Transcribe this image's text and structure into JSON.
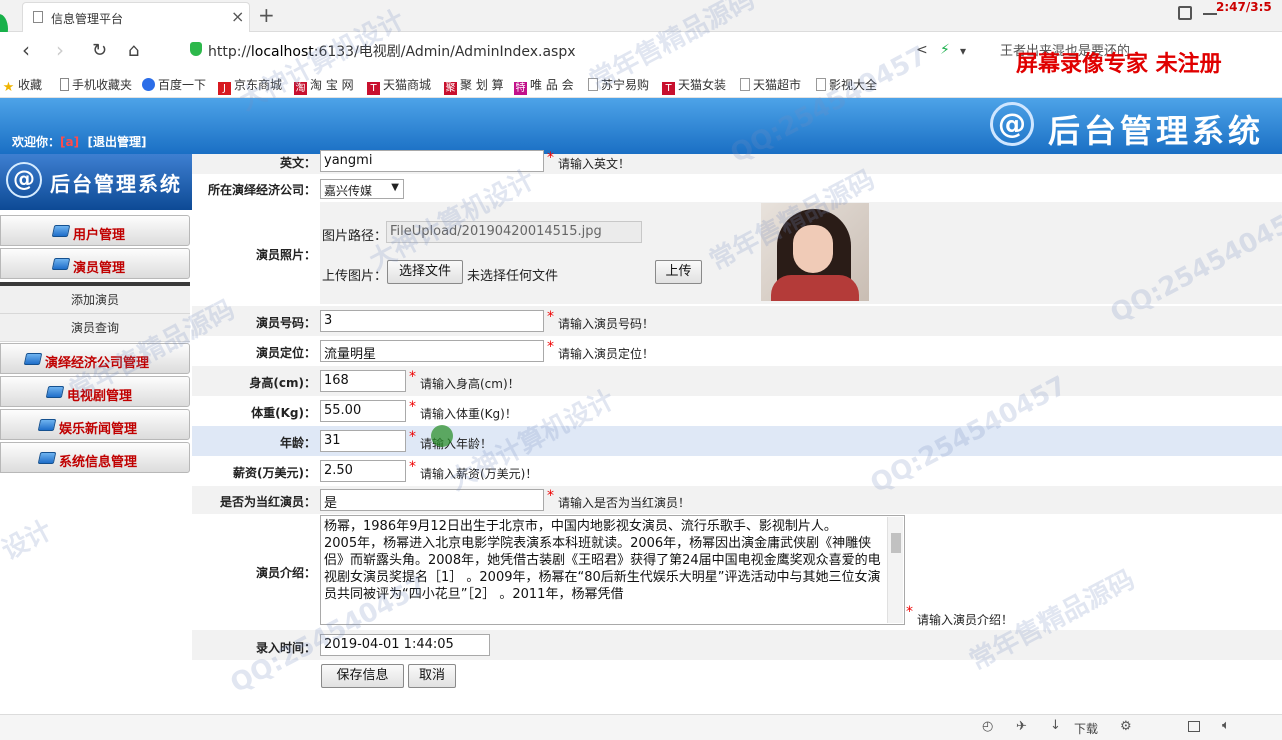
{
  "browser": {
    "tab_title": "信息管理平台",
    "tab_close": "×",
    "new_tab": "+",
    "url_prefix": "http://",
    "url_host": "localhost",
    "url_rest": ":6133/电视剧/Admin/AdminIndex.aspx",
    "search_text": "王者出来混也是要还的",
    "clock": "2:47/3:5"
  },
  "recorder_watermark": "屏幕录像专家 未注册",
  "bookmarks": [
    {
      "label": "收藏",
      "icon": "star-icon",
      "color": "#f0b400"
    },
    {
      "label": "手机收藏夹",
      "icon": "phone-icon",
      "color": "#888888"
    },
    {
      "label": "百度一下",
      "icon": "paw-icon",
      "color": "#2b6de8"
    },
    {
      "label": "京东商城",
      "icon": "jd-icon",
      "color": "#d71920"
    },
    {
      "label": "淘 宝 网",
      "icon": "taobao-icon",
      "color": "#c8102e"
    },
    {
      "label": "天猫商城",
      "icon": "tmall-icon",
      "color": "#c8102e"
    },
    {
      "label": "聚 划 算",
      "icon": "ju-icon",
      "color": "#c8102e"
    },
    {
      "label": "唯 品 会",
      "icon": "vip-icon",
      "color": "#c2118a"
    },
    {
      "label": "苏宁易购",
      "icon": "page-icon",
      "color": "#888888"
    },
    {
      "label": "天猫女装",
      "icon": "tmall-icon",
      "color": "#c8102e"
    },
    {
      "label": "天猫超市",
      "icon": "page-icon",
      "color": "#888888"
    },
    {
      "label": "影视大全",
      "icon": "page-icon",
      "color": "#888888"
    }
  ],
  "header": {
    "welcome": "欢迎你：",
    "user": "[a]",
    "logout": "[退出管理]",
    "logo_text": "后台管理系统"
  },
  "sidebar": {
    "logo_text": "后台管理系统",
    "menu": [
      "用户管理",
      "演员管理",
      "演绎经济公司管理",
      "电视剧管理",
      "娱乐新闻管理",
      "系统信息管理"
    ],
    "sub": [
      "添加演员",
      "演员查询"
    ]
  },
  "form": {
    "english": {
      "label": "英文：",
      "value": "yangmi",
      "hint": "请输入英文！"
    },
    "company": {
      "label": "所在演绎经济公司：",
      "value": "嘉兴传媒"
    },
    "photo": {
      "label": "演员照片：",
      "path_label": "图片路径：",
      "path": "FileUpload/20190420014515.jpg",
      "upload_label": "上传图片：",
      "choose_btn": "选择文件",
      "no_file": "未选择任何文件",
      "upload_btn": "上传"
    },
    "number": {
      "label": "演员号码：",
      "value": "3",
      "hint": "请输入演员号码！"
    },
    "position": {
      "label": "演员定位：",
      "value": "流量明星",
      "hint": "请输入演员定位！"
    },
    "height": {
      "label": "身高(cm)：",
      "value": "168",
      "hint": "请输入身高(cm)！"
    },
    "weight": {
      "label": "体重(Kg)：",
      "value": "55.00",
      "hint": "请输入体重(Kg)！"
    },
    "age": {
      "label": "年龄：",
      "value": "31",
      "hint": "请输入年龄！"
    },
    "salary": {
      "label": "薪资(万美元)：",
      "value": "2.50",
      "hint": "请输入薪资(万美元)！"
    },
    "popular": {
      "label": "是否为当红演员：",
      "value": "是",
      "hint": "请输入是否为当红演员！"
    },
    "intro": {
      "label": "演员介绍：",
      "value": "杨幂，1986年9月12日出生于北京市，中国内地影视女演员、流行乐歌手、影视制片人。\n2005年，杨幂进入北京电影学院表演系本科班就读。2006年，杨幂因出演金庸武侠剧《神雕侠侣》而崭露头角。2008年，她凭借古装剧《王昭君》获得了第24届中国电视金鹰奖观众喜爱的电视剧女演员奖提名［1］ 。2009年，杨幂在“80后新生代娱乐大明星”评选活动中与其她三位女演员共同被评为“四小花旦”［2］ 。2011年，杨幂凭借",
      "hint": "请输入演员介绍！"
    },
    "time": {
      "label": "录入时间：",
      "value": "2019-04-01 1:44:05"
    },
    "save_btn": "保存信息",
    "cancel_btn": "取消",
    "required_mark": "*"
  },
  "statusbar": {
    "download": "下载"
  },
  "watermarks": [
    "常年售精品源码",
    "大神计算机设计",
    "QQ:254540457",
    "常年售精品源码",
    "大神计算机设计",
    "QQ:254540457",
    "常年售精品源码",
    "大神计算机设计",
    "QQ:254540457",
    "设计",
    "QQ:254540457",
    "常年售精品源码"
  ]
}
